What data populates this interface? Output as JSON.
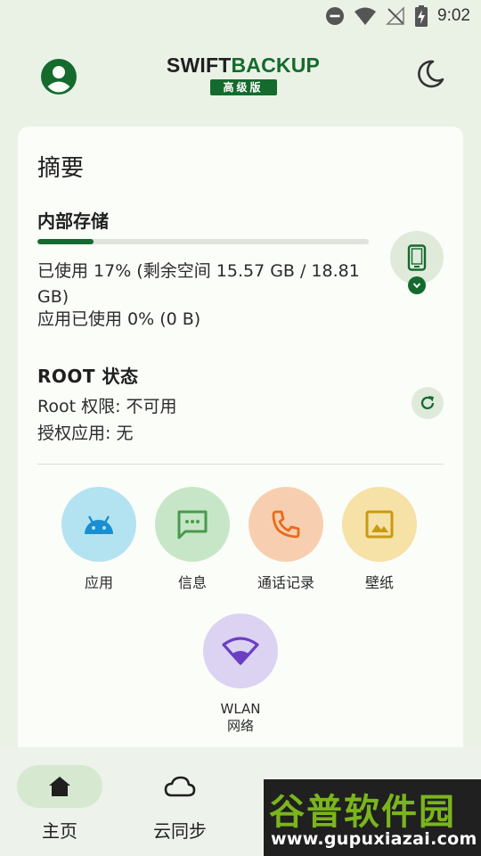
{
  "status_bar": {
    "time": "9:02"
  },
  "header": {
    "logo_part1": "SWIFT",
    "logo_part2": "BACKUP",
    "logo_badge": "高级版"
  },
  "summary": {
    "title": "摘要",
    "storage": {
      "title": "内部存储",
      "used_fraction": 0.17,
      "usage_text": "已使用 17% (剩余空间 15.57 GB / 18.81 GB)",
      "app_usage_text": "应用已使用 0% (0 B)"
    },
    "root": {
      "title": "ROOT 状态",
      "permission_text": "Root 权限: 不可用",
      "authorized_apps_text": "授权应用: 无"
    },
    "categories": [
      {
        "label": "应用",
        "icon": "android-icon",
        "color": "#b3e3f0"
      },
      {
        "label": "信息",
        "icon": "message-icon",
        "color": "#c7e6c7"
      },
      {
        "label": "通话记录",
        "icon": "phone-icon",
        "color": "#f7cfb0"
      },
      {
        "label": "壁纸",
        "icon": "wallpaper-icon",
        "color": "#f6e1a6"
      },
      {
        "label": "WLAN\n网络",
        "icon": "wifi-icon",
        "color": "#dcd2f2"
      }
    ]
  },
  "bottom_nav": {
    "items": [
      {
        "label": "主页",
        "icon": "home-icon",
        "active": true
      },
      {
        "label": "云同步",
        "icon": "cloud-icon",
        "active": false
      }
    ]
  },
  "watermark": {
    "title": "谷普软件园",
    "url": "www.gupuxiazai.com"
  },
  "colors": {
    "accent": "#156a2e",
    "background": "#eaf2e6",
    "card": "#fbfdf9"
  }
}
